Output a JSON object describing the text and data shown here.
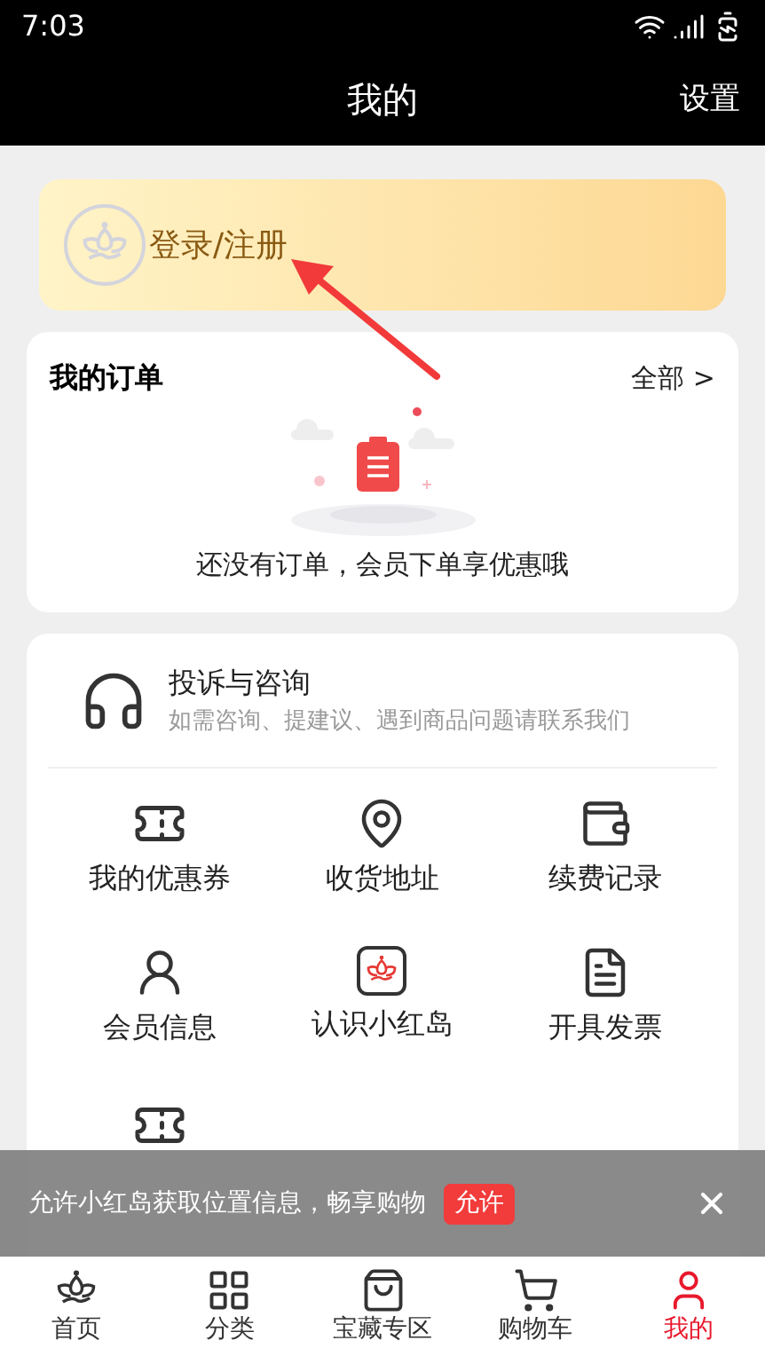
{
  "status_bar": {
    "time": "7:03"
  },
  "header": {
    "title": "我的",
    "action": "设置"
  },
  "login": {
    "label": "登录/注册"
  },
  "orders": {
    "title": "我的订单",
    "link": "全部 >",
    "empty_text": "还没有订单，会员下单享优惠哦"
  },
  "support": {
    "title": "投诉与咨询",
    "subtitle": "如需咨询、提建议、遇到商品问题请联系我们"
  },
  "services": [
    {
      "label": "我的优惠券"
    },
    {
      "label": "收货地址"
    },
    {
      "label": "续费记录"
    },
    {
      "label": "会员信息"
    },
    {
      "label": "认识小红岛"
    },
    {
      "label": "开具发票"
    }
  ],
  "toast": {
    "text": "允许小红岛获取位置信息，畅享购物",
    "button": "允许"
  },
  "tabbar": [
    {
      "label": "首页",
      "selected": false
    },
    {
      "label": "分类",
      "selected": false
    },
    {
      "label": "宝藏专区",
      "selected": false
    },
    {
      "label": "购物车",
      "selected": false
    },
    {
      "label": "我的",
      "selected": true
    }
  ]
}
